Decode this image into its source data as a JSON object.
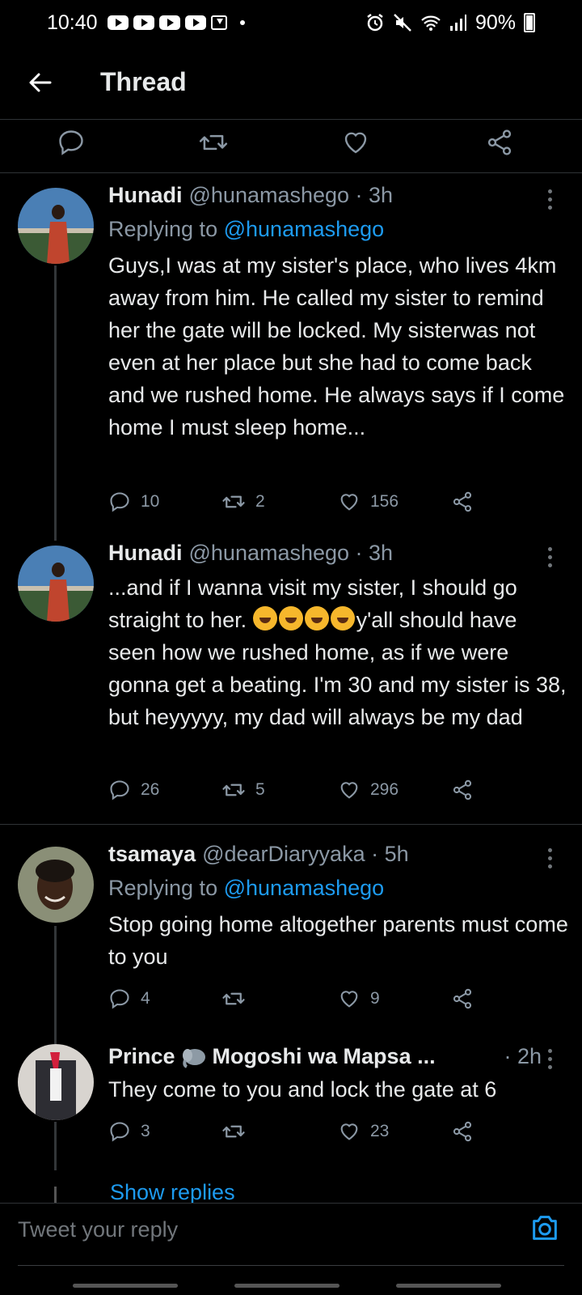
{
  "status_bar": {
    "time": "10:40",
    "battery": "90%"
  },
  "header": {
    "title": "Thread"
  },
  "tweets": [
    {
      "name": "Hunadi",
      "handle": "@hunamashego · 3h",
      "replying_label": "Replying to",
      "replying_handle": "@hunamashego",
      "text": "Guys,I was at my sister's place, who lives 4km away from him. He called my sister to remind her the gate will be locked. My sisterwas not even at her place but she had to come back and we rushed home. He always says if I come home  I must sleep home...",
      "replies": "10",
      "retweets": "2",
      "likes": "156"
    },
    {
      "name": "Hunadi",
      "handle": "@hunamashego · 3h",
      "text_part1": "...and if I wanna visit my sister, I should go straight to her. ",
      "text_part2": "y'all should have seen how we rushed home, as if we were gonna get a beating. I'm 30 and my sister is 38, but heyyyyy, my dad will always be my dad",
      "replies": "26",
      "retweets": "5",
      "likes": "296"
    },
    {
      "name": "tsamaya",
      "handle": "@dearDiaryyaka · 5h",
      "replying_label": "Replying to",
      "replying_handle": "@hunamashego",
      "text": "Stop going home altogether parents must come to you",
      "replies": "4",
      "retweets": "",
      "likes": "9"
    },
    {
      "name": "Prince",
      "name_rest": "Mogoshi wa Mapsa ...",
      "handle": "· 2h",
      "text": "They come to you and lock the gate at 6",
      "replies": "3",
      "retweets": "",
      "likes": "23"
    }
  ],
  "show_replies": "Show replies",
  "composer": {
    "placeholder": "Tweet your reply"
  },
  "colors": {
    "accent": "#1d9bf0",
    "background": "#000000",
    "secondary_text": "#8b98a5"
  }
}
